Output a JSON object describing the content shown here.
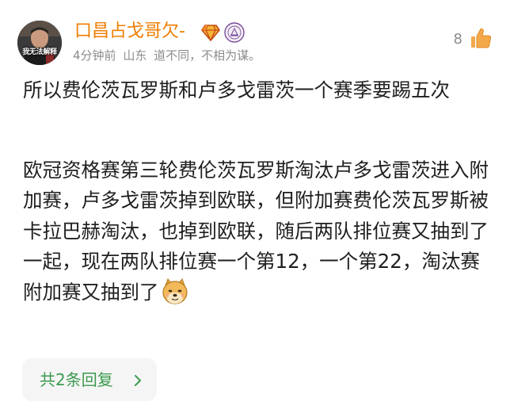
{
  "comment": {
    "avatar": {
      "caption": "我无法解释",
      "icon": "avatar-photo"
    },
    "username": "口昌占戈哥欠-",
    "badges": [
      "diamond-badge-icon",
      "university-seal-icon"
    ],
    "meta": {
      "time": "4分钟前",
      "location": "山东",
      "signature": "道不同，不相为谋。"
    },
    "likes": {
      "count": "8",
      "icon": "thumbs-up-icon"
    },
    "content": {
      "paragraph_1": "所以费伦茨瓦罗斯和卢多戈雷茨一个赛季要踢五次",
      "paragraph_2": "欧冠资格赛第三轮费伦茨瓦罗斯淘汰卢多戈雷茨进入附加赛，卢多戈雷茨掉到欧联，但附加赛费伦茨瓦罗斯被卡拉巴赫淘汰，也掉到欧联，随后两队排位赛又抽到了一起，现在两队排位赛一个第12，一个第22，淘汰赛附加赛又抽到了",
      "emoji": "doge-emoji-icon"
    },
    "replies": {
      "label": "共2条回复",
      "icon": "chevron-right-icon"
    }
  },
  "colors": {
    "username": "#ef7d00",
    "meta": "#8c8c8c",
    "body_text": "#1f1f1f",
    "replies_text": "#3c9a4f",
    "replies_bg": "#f5f5f5"
  }
}
